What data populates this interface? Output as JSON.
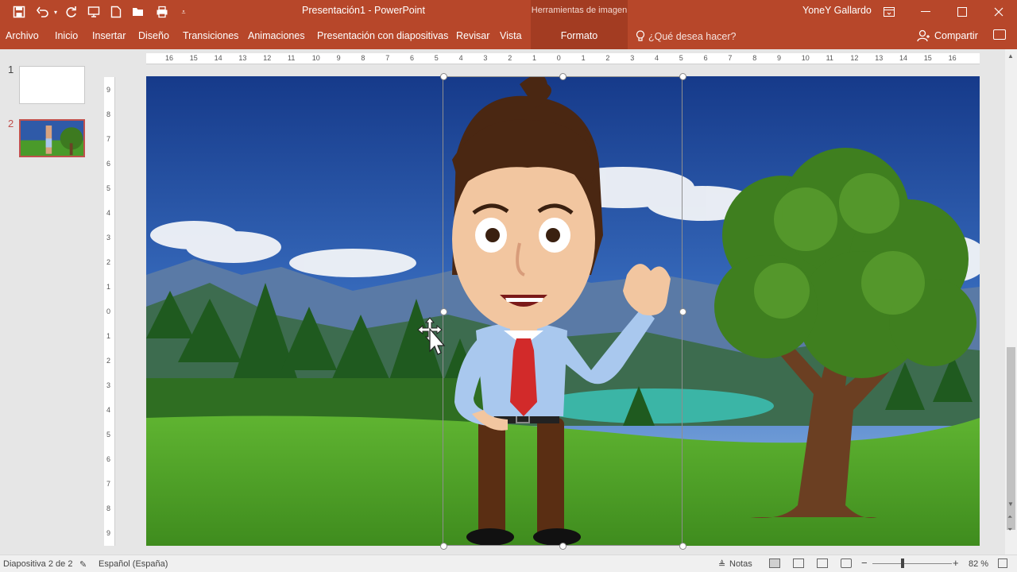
{
  "titlebar": {
    "app_title": "Presentación1  -  PowerPoint",
    "tools_group": "Herramientas de imagen",
    "user": "YoneY Gallardo"
  },
  "ribbon": {
    "tabs": [
      "Archivo",
      "Inicio",
      "Insertar",
      "Diseño",
      "Transiciones",
      "Animaciones",
      "Presentación con diapositivas",
      "Revisar",
      "Vista"
    ],
    "active_tool_tab": "Formato",
    "search_placeholder": "¿Qué desea hacer?",
    "share_label": "Compartir"
  },
  "thumbnails": {
    "items": [
      {
        "number": "1"
      },
      {
        "number": "2"
      }
    ]
  },
  "ruler": {
    "horizontal_labels": [
      "16",
      "15",
      "14",
      "13",
      "12",
      "11",
      "10",
      "9",
      "8",
      "7",
      "6",
      "5",
      "4",
      "3",
      "2",
      "1",
      "0",
      "1",
      "2",
      "3",
      "4",
      "5",
      "6",
      "7",
      "8",
      "9",
      "10",
      "11",
      "12",
      "13",
      "14",
      "15",
      "16"
    ],
    "vertical_labels": [
      "9",
      "8",
      "7",
      "6",
      "5",
      "4",
      "3",
      "2",
      "1",
      "0",
      "1",
      "2",
      "3",
      "4",
      "5",
      "6",
      "7",
      "8",
      "9"
    ]
  },
  "statusbar": {
    "slide_info": "Diapositiva 2 de 2",
    "language": "Español (España)",
    "notes_label": "Notas",
    "zoom_minus": "−",
    "zoom_plus": "+",
    "zoom_level": "82 %"
  },
  "colors": {
    "accent": "#b7472a",
    "tool_tab": "#a33c22",
    "selected_thumb_border": "#c0504d"
  }
}
